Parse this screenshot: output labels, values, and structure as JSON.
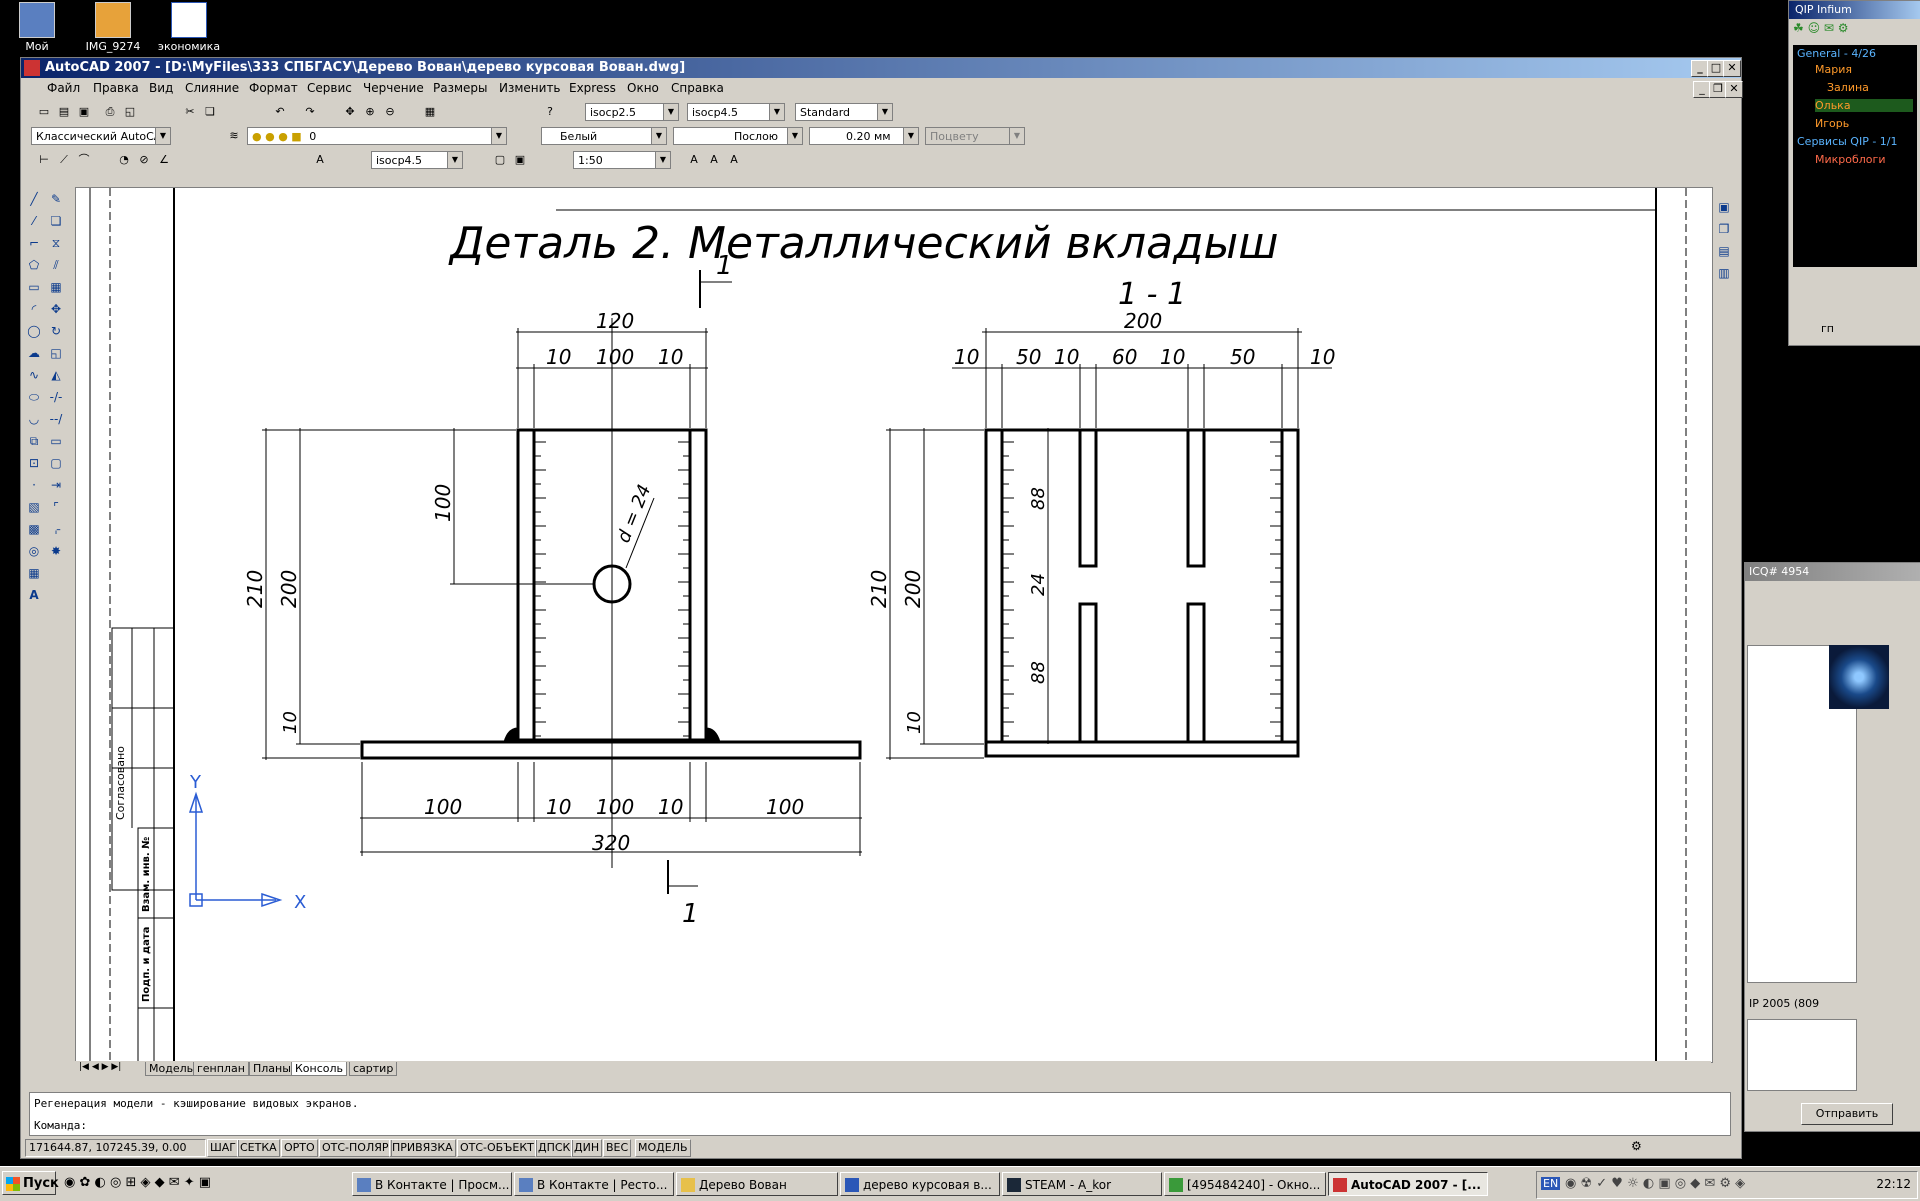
{
  "desktop": {
    "icons": [
      {
        "label": "Мой"
      },
      {
        "label": "IMG_9274"
      },
      {
        "label": "экономика"
      }
    ]
  },
  "cad": {
    "title": "AutoCAD 2007 - [D:\\MyFiles\\333 СПБГАСУ\\Дерево Вован\\дерево курсовая Вован.dwg]",
    "menu": [
      "Файл",
      "Правка",
      "Вид",
      "Слияние",
      "Формат",
      "Сервис",
      "Черчение",
      "Размеры",
      "Изменить",
      "Express",
      "Окно",
      "Справка"
    ],
    "toolbar": {
      "text_style": "isocp2.5",
      "dim_style": "isocp4.5",
      "table_style": "Standard",
      "workspace": "Классический AutoCAD",
      "layer": "0",
      "color": "Белый",
      "linetype": "Послою",
      "lineweight": "0.20 мм",
      "plotstyle": "Поцвету",
      "font_style": "isocp4.5",
      "scale": "1:50"
    },
    "drawing": {
      "title": "Деталь 2. Металлический вкладыш",
      "section_mark": "1",
      "section_title": "1 - 1",
      "stamp_agreed": "Согласовано",
      "stamp_inv": "Взам. инв. №",
      "stamp_sign": "Подп. и дата",
      "ucs_x": "X",
      "ucs_y": "Y",
      "front_dims": {
        "top_total": "120",
        "top_10a": "10",
        "top_100": "100",
        "top_10b": "10",
        "left_210": "210",
        "left_200": "200",
        "left_100": "100",
        "left_10": "10",
        "hole": "d = 24",
        "bot_100a": "100",
        "bot_10a": "10",
        "bot_100": "100",
        "bot_10b": "10",
        "bot_100b": "100",
        "bot_total": "320"
      },
      "side_dims": {
        "top_total": "200",
        "t1": "10",
        "t2": "50",
        "t3": "10",
        "t4": "60",
        "t5": "10",
        "t6": "50",
        "t7": "10",
        "left_210": "210",
        "left_200": "200",
        "left_10": "10",
        "in_88a": "88",
        "in_24": "24",
        "in_88b": "88"
      }
    },
    "tabs": [
      "Модель",
      "генплан",
      "Планы",
      "Консоль",
      "сартир"
    ],
    "active_tab": "Консоль",
    "command_history": "Регенерация модели - кэширование видовых экранов.",
    "command_prompt": "Команда:",
    "coords": "171644.87, 107245.39, 0.00",
    "status_buttons": [
      "ШАГ",
      "СЕТКА",
      "ОРТО",
      "ОТС-ПОЛЯР",
      "ПРИВЯЗКА",
      "ОТС-ОБЪЕКТ",
      "ДПСК",
      "ДИН",
      "ВЕС",
      "МОДЕЛЬ"
    ]
  },
  "qip": {
    "title": "QIP Infium",
    "group": "General - 4/26",
    "contacts": [
      "Мария",
      "Залина",
      "Олька",
      "Игорь"
    ],
    "group2": "Сервисы QIP - 1/1",
    "service": "Микроблоги",
    "bottom_label": "гп"
  },
  "icq": {
    "title": "ICQ# 4954",
    "status_text": "IP 2005 (809",
    "send_label": "Отправить"
  },
  "taskbar": {
    "start": "Пуск",
    "items": [
      "В Контакте | Просм...",
      "В Контакте | Ресто...",
      "Дерево Вован",
      "дерево курсовая в...",
      "STEAM - A_kor",
      "[495484240] - Окно...",
      "AutoCAD 2007 - [..."
    ],
    "lang": "EN",
    "clock": "22:12"
  }
}
